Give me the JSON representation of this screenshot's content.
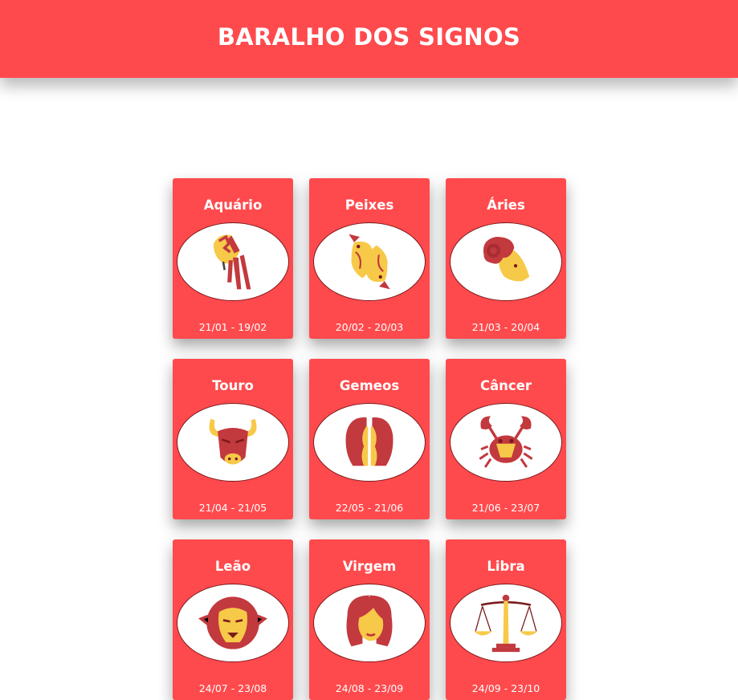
{
  "header": {
    "title": "BARALHO DOS SIGNOS"
  },
  "colors": {
    "brand": "#ff4a4d",
    "icon_red": "#c2393e",
    "icon_yellow": "#f7c948",
    "icon_dark": "#7a1a1c"
  },
  "cards": [
    {
      "name": "Aquário",
      "dates": "21/01 - 19/02",
      "icon": "aquarius-icon"
    },
    {
      "name": "Peixes",
      "dates": "20/02 - 20/03",
      "icon": "pisces-icon"
    },
    {
      "name": "Áries",
      "dates": "21/03 - 20/04",
      "icon": "aries-icon"
    },
    {
      "name": "Touro",
      "dates": "21/04 - 21/05",
      "icon": "taurus-icon"
    },
    {
      "name": "Gemeos",
      "dates": "22/05 - 21/06",
      "icon": "gemini-icon"
    },
    {
      "name": "Câncer",
      "dates": "21/06 - 23/07",
      "icon": "cancer-icon"
    },
    {
      "name": "Leão",
      "dates": "24/07 - 23/08",
      "icon": "leo-icon"
    },
    {
      "name": "Virgem",
      "dates": "24/08 - 23/09",
      "icon": "virgo-icon"
    },
    {
      "name": "Libra",
      "dates": "24/09 - 23/10",
      "icon": "libra-icon"
    }
  ]
}
